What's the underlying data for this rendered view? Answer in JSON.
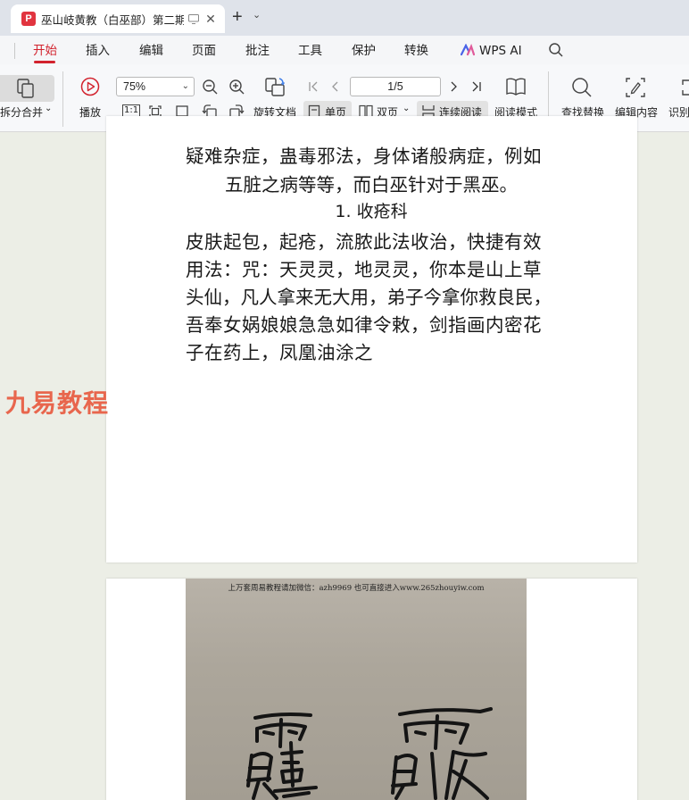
{
  "tab": {
    "logo_glyph": "P",
    "title": "巫山岐黄教（白巫部）第二期",
    "new_tab_glyph": "+",
    "close_glyph": "✕"
  },
  "menu": {
    "items": [
      "开始",
      "插入",
      "编辑",
      "页面",
      "批注",
      "工具",
      "保护",
      "转换"
    ],
    "active": "开始",
    "wps_ai": "WPS AI",
    "active_color": "#d2222d"
  },
  "toolbar": {
    "split_merge": "拆分合并",
    "play": "播放",
    "zoom": "75%",
    "page_indicator": "1/5",
    "rotate": "旋转文档",
    "single_page": "单页",
    "double_page": "双页",
    "continuous": "连续阅读",
    "read_mode": "阅读模式",
    "find_replace": "查找替换",
    "edit_content": "编辑内容",
    "recognize": "识别",
    "actual_size": "1:1"
  },
  "document": {
    "lines": [
      "疑难杂症，蛊毒邪法，身体诸般病症，例如",
      "五脏之病等等，而白巫针对于黑巫。",
      "1. 收疮科",
      "皮肤起包，起疮，流脓此法收治，快捷有效",
      "用法：咒：天灵灵，地灵灵，你本是山上草",
      "头仙，凡人拿来无大用，弟子今拿你救良民，",
      "吾奉女娲娘娘急急如律令敕，剑指画内密花",
      "子在药上，凤凰油涂之"
    ],
    "watermark": "九易教程",
    "scan_header": "上万套周易教程请加微信：azh9969  也可直接进入www.265zhouyiw.com"
  }
}
